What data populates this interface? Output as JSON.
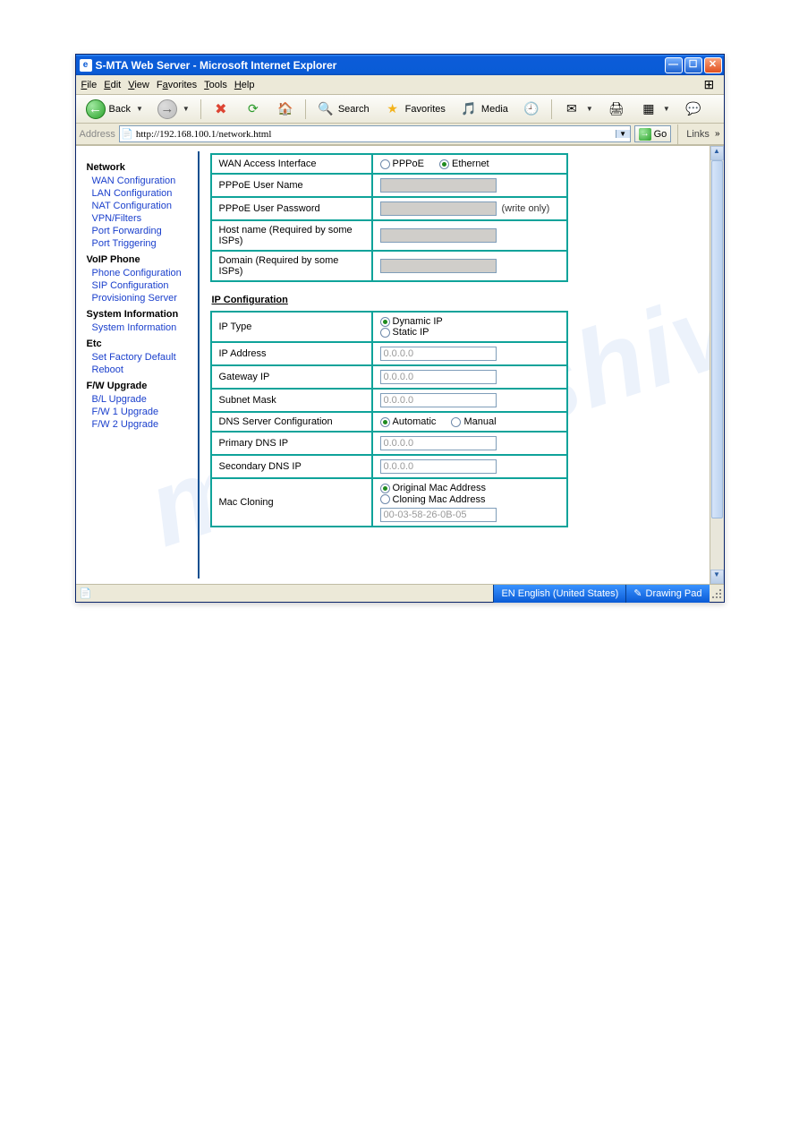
{
  "doc": {
    "url_text": "http://192.168.100.1/network.html",
    "url_href": "http://192.168.100.1/network.html"
  },
  "window": {
    "title": "S-MTA Web Server - Microsoft Internet Explorer"
  },
  "menu": {
    "file": "File",
    "edit": "Edit",
    "view": "View",
    "favorites": "Favorites",
    "tools": "Tools",
    "help": "Help"
  },
  "toolbar": {
    "back": "Back",
    "search": "Search",
    "favorites": "Favorites",
    "media": "Media"
  },
  "addressbar": {
    "label": "Address",
    "url": "http://192.168.100.1/network.html",
    "go": "Go",
    "links": "Links"
  },
  "sidebar": {
    "groups": [
      {
        "title": "Network",
        "items": [
          "WAN Configuration",
          "LAN Configuration",
          "NAT Configuration",
          "VPN/Filters",
          "Port Forwarding",
          "Port Triggering"
        ]
      },
      {
        "title": "VoIP Phone",
        "items": [
          "Phone Configuration",
          "SIP Configuration",
          "Provisioning Server"
        ]
      },
      {
        "title": "System Information",
        "items": [
          "System Information"
        ]
      },
      {
        "title": "Etc",
        "items": [
          "Set Factory Default",
          "Reboot"
        ]
      },
      {
        "title": "F/W Upgrade",
        "items": [
          "B/L Upgrade",
          "F/W 1 Upgrade",
          "F/W 2 Upgrade"
        ]
      }
    ]
  },
  "wan_table": {
    "rows": {
      "access_if": "WAN Access Interface",
      "pppoe_opt": "PPPoE",
      "eth_opt": "Ethernet",
      "user": "PPPoE User Name",
      "pass": "PPPoE User Password",
      "pass_note": "(write only)",
      "host": "Host name (Required by some ISPs)",
      "domain": "Domain (Required by some ISPs)"
    }
  },
  "ip_section_title": "IP Configuration",
  "ip_table": {
    "iptype": "IP Type",
    "dyn": "Dynamic IP",
    "stat": "Static IP",
    "ipaddr": "IP Address",
    "gw": "Gateway IP",
    "mask": "Subnet Mask",
    "dnscfg": "DNS Server Configuration",
    "auto": "Automatic",
    "manual": "Manual",
    "pdns": "Primary DNS IP",
    "sdns": "Secondary DNS IP",
    "maccln": "Mac Cloning",
    "orig": "Original Mac Address",
    "clone": "Cloning Mac Address",
    "placeholder": "0.0.0.0",
    "mac_value": "00-03-58-26-0B-05"
  },
  "statusbar": {
    "lang": "EN English (United States)",
    "drawing": "Drawing Pad"
  }
}
